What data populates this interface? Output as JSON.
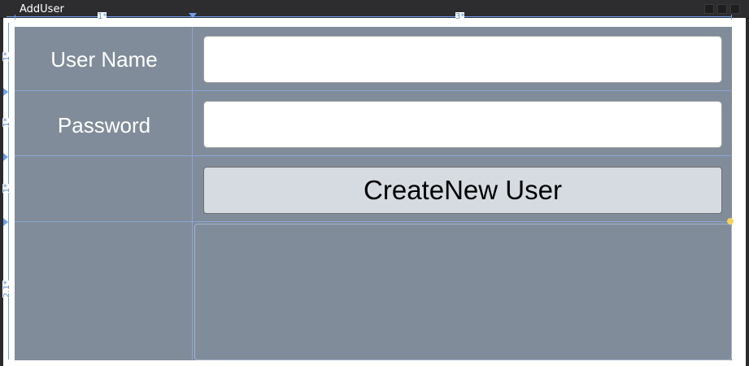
{
  "window": {
    "title": "AddUser"
  },
  "rulers": {
    "column_sizes": [
      "1*",
      "3*"
    ],
    "row_sizes": [
      "1*",
      "1*",
      "1*",
      "2.1*"
    ]
  },
  "form": {
    "username_label": "User Name",
    "username_value": "",
    "password_label": "Password",
    "password_value": "",
    "create_button_label": "CreateNew User"
  },
  "colors": {
    "grid_background": "#808c99",
    "guide": "#6f9ff0",
    "button_background": "#d5dbe1"
  }
}
